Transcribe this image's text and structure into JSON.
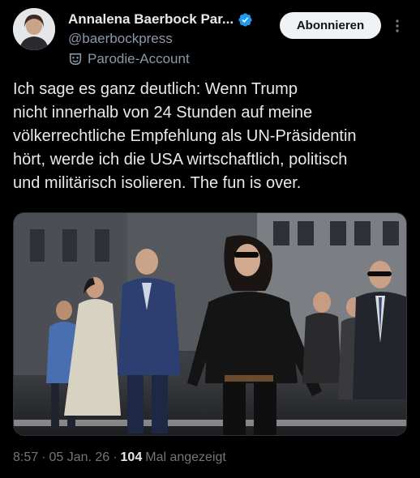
{
  "author": {
    "display_name": "Annalena Baerbock Par...",
    "handle": "@baerbockpress",
    "parody_label": "Parodie-Account",
    "verified_color": "#1d9bf0"
  },
  "actions": {
    "subscribe_label": "Abonnieren"
  },
  "tweet": {
    "text": "Ich sage es ganz deutlich: Wenn Trump\nnicht innerhalb von 24 Stunden auf meine\nvölkerrechtliche Empfehlung als UN-Präsidentin\nhört, werde ich die USA wirtschaftlich, politisch\nund militärisch isolieren. The fun is over."
  },
  "media": {
    "description_icon": "photo"
  },
  "meta": {
    "time": "8:57",
    "separator1": "·",
    "date": "05 Jan. 26",
    "separator2": "·",
    "views_count": "104",
    "views_label": "Mal angezeigt"
  }
}
